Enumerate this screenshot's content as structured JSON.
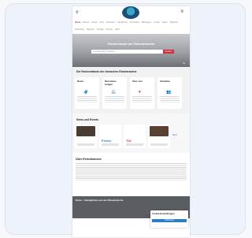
{
  "site": {
    "nav_items": [
      "Home",
      "Reisen",
      "Hotels",
      "Flug",
      "Pauschal",
      "Last Minute",
      "Kreuzfahrt",
      "Mietwagen",
      "Urlaub",
      "Deals",
      "Ratgeber",
      "Reiseziele",
      "Magazin",
      "Kontakt",
      "Partner",
      "Mehr"
    ],
    "nav_active_index": 0
  },
  "hero": {
    "title": "Fachverband der Reisebranche",
    "search_placeholder": "Suchbegriff eingeben",
    "search_button": "Suchen",
    "badge": "i ▸"
  },
  "services": {
    "heading": "Die Fachverbände der deutschen Reisebranche",
    "tiles": [
      {
        "title": "Reise",
        "icon": "suitcase-icon"
      },
      {
        "title": "Dienstleis- tungen",
        "icon": "bell-icon"
      },
      {
        "title": "Über uns",
        "icon": "heart-icon"
      },
      {
        "title": "Aktuelles",
        "icon": "people-icon"
      }
    ]
  },
  "brands": {
    "heading": "News und Events",
    "items": [
      {
        "label": "",
        "img_color": "#4a3b33"
      },
      {
        "label": "Ferien",
        "img_color": "#ffffff",
        "label_color": "#2a7fc4"
      },
      {
        "label": "TUI",
        "img_color": "#ffffff",
        "label_color": "#d12e3b"
      },
      {
        "label": "",
        "img_color": "#5a4030"
      }
    ],
    "more": "Mehr"
  },
  "about": {
    "heading": "Über Reisebranche"
  },
  "dark_section": {
    "title": "Reise – Neuigkeiten aus der Reisebranche"
  },
  "cookie": {
    "title": "Cookie-Einstellungen",
    "button": "Zustimmen"
  }
}
